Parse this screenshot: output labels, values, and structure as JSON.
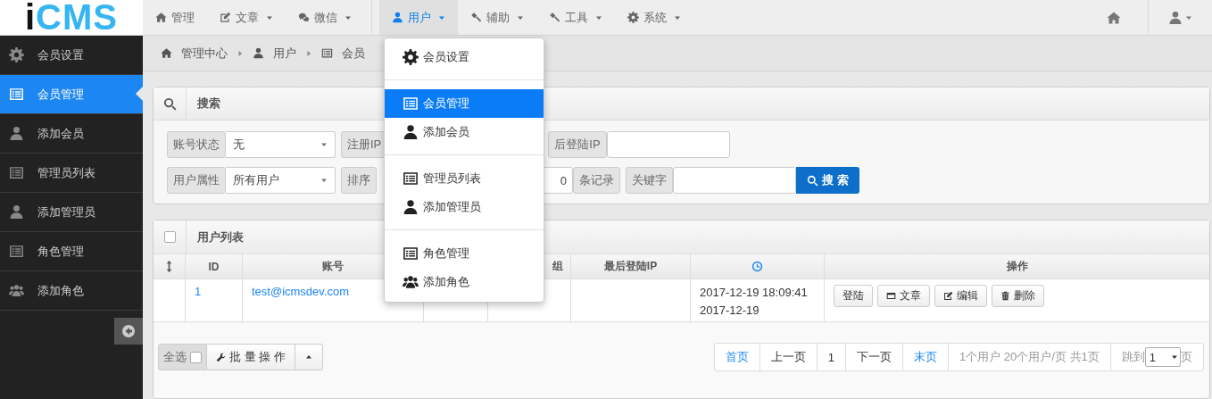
{
  "logo": {
    "first": "i",
    "rest": "CMS"
  },
  "nav": [
    {
      "label": "管理",
      "caret": false,
      "selected": false
    },
    {
      "label": "文章",
      "caret": true,
      "selected": false
    },
    {
      "label": "微信",
      "caret": true,
      "selected": false
    },
    {
      "label": "用户",
      "caret": true,
      "selected": true
    },
    {
      "label": "辅助",
      "caret": true,
      "selected": false
    },
    {
      "label": "工具",
      "caret": true,
      "selected": false
    },
    {
      "label": "系统",
      "caret": true,
      "selected": false
    }
  ],
  "sidebar": {
    "items": [
      {
        "label": "会员设置",
        "selected": false
      },
      {
        "label": "会员管理",
        "selected": true
      },
      {
        "label": "添加会员",
        "selected": false
      },
      {
        "label": "管理员列表",
        "selected": false
      },
      {
        "label": "添加管理员",
        "selected": false
      },
      {
        "label": "角色管理",
        "selected": false
      },
      {
        "label": "添加角色",
        "selected": false
      }
    ]
  },
  "breadcrumb": [
    "管理中心",
    "用户",
    "会员"
  ],
  "menu": {
    "groups": [
      {
        "items": [
          {
            "label": "会员设置",
            "selected": false
          }
        ]
      },
      {
        "items": [
          {
            "label": "会员管理",
            "selected": true
          },
          {
            "label": "添加会员",
            "selected": false
          }
        ]
      },
      {
        "items": [
          {
            "label": "管理员列表",
            "selected": false
          },
          {
            "label": "添加管理员",
            "selected": false
          }
        ]
      },
      {
        "items": [
          {
            "label": "角色管理",
            "selected": false
          },
          {
            "label": "添加角色",
            "selected": false
          }
        ]
      }
    ]
  },
  "search": {
    "title": "搜索",
    "status": {
      "label": "账号状态",
      "value": "无"
    },
    "reg_ip": {
      "label": "注册IP"
    },
    "last_ip": {
      "label": "后登陆IP"
    },
    "attr": {
      "label": "用户属性",
      "value": "所有用户"
    },
    "sort": {
      "label": "排序"
    },
    "per_page": {
      "value": "0",
      "unit": "条记录"
    },
    "keyword": {
      "label": "关键字"
    },
    "button": "搜 索"
  },
  "table": {
    "title": "用户列表",
    "checked": false,
    "columns": [
      "ID",
      "账号",
      "组",
      "最后登陆IP",
      "操作"
    ],
    "rows": [
      {
        "id": "1",
        "account": "test@icmsdev.com",
        "time": "2017-12-19 18:09:41",
        "date": "2017-12-19",
        "actions": [
          "登陆",
          "文章",
          "编辑",
          "删除"
        ]
      }
    ]
  },
  "footer": {
    "select_all": {
      "label": "全选",
      "checked": false
    },
    "batch": "批 量 操 作",
    "pages": [
      {
        "label": "首页",
        "kind": "link"
      },
      {
        "label": "上一页",
        "kind": "plain"
      },
      {
        "label": "1",
        "kind": "plain"
      },
      {
        "label": "下一页",
        "kind": "plain"
      },
      {
        "label": "末页",
        "kind": "link"
      }
    ],
    "info": "1个用户 20个用户/页 共1页",
    "jump": {
      "label": "跳到",
      "value": "1",
      "unit": "页"
    }
  }
}
